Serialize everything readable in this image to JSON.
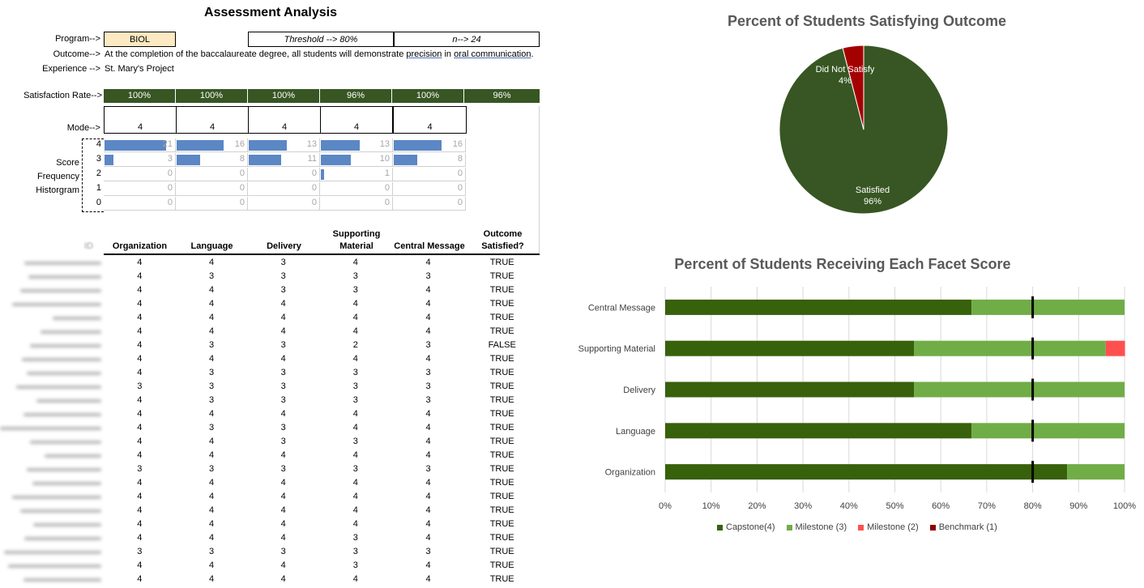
{
  "sheet": {
    "title": "Assessment Analysis",
    "program_label": "Program-->",
    "program_value": "BIOL",
    "threshold": "Threshold -->  80%",
    "n": "n-->  24",
    "outcome_label": "Outcome-->",
    "outcome_text_1": "At the completion of the baccalaureate degree, all students will demonstrate ",
    "outcome_word_1": "precision",
    "outcome_text_2": " in ",
    "outcome_word_2": "oral communication",
    "outcome_text_3": ".",
    "experience_label": "Experience -->",
    "experience_value": "St. Mary's Project",
    "satisfaction_label": "Satisfaction Rate-->",
    "satisfaction_rates": [
      "100%",
      "100%",
      "100%",
      "96%",
      "100%",
      "96%"
    ],
    "mode_label": "Mode-->",
    "modes": [
      "4",
      "4",
      "4",
      "4",
      "4"
    ],
    "hist_labels": [
      "Score",
      "Frequency",
      "Historgram"
    ],
    "hist_scores": [
      "4",
      "3",
      "2",
      "1",
      "0"
    ],
    "hist_counts": [
      [
        21,
        16,
        13,
        13,
        16
      ],
      [
        3,
        8,
        11,
        10,
        8
      ],
      [
        0,
        0,
        0,
        1,
        0
      ],
      [
        0,
        0,
        0,
        0,
        0
      ],
      [
        0,
        0,
        0,
        0,
        0
      ]
    ],
    "id_header": "ID",
    "columns": [
      "Organization",
      "Language",
      "Delivery",
      "Supporting Material",
      "Central Message",
      "Outcome Satisfied?"
    ],
    "rows": [
      [
        "4",
        "4",
        "3",
        "4",
        "4",
        "TRUE"
      ],
      [
        "4",
        "3",
        "3",
        "3",
        "3",
        "TRUE"
      ],
      [
        "4",
        "4",
        "3",
        "3",
        "4",
        "TRUE"
      ],
      [
        "4",
        "4",
        "4",
        "4",
        "4",
        "TRUE"
      ],
      [
        "4",
        "4",
        "4",
        "4",
        "4",
        "TRUE"
      ],
      [
        "4",
        "4",
        "4",
        "4",
        "4",
        "TRUE"
      ],
      [
        "4",
        "3",
        "3",
        "2",
        "3",
        "FALSE"
      ],
      [
        "4",
        "4",
        "4",
        "4",
        "4",
        "TRUE"
      ],
      [
        "4",
        "3",
        "3",
        "3",
        "3",
        "TRUE"
      ],
      [
        "3",
        "3",
        "3",
        "3",
        "3",
        "TRUE"
      ],
      [
        "4",
        "3",
        "3",
        "3",
        "3",
        "TRUE"
      ],
      [
        "4",
        "4",
        "4",
        "4",
        "4",
        "TRUE"
      ],
      [
        "4",
        "3",
        "3",
        "4",
        "4",
        "TRUE"
      ],
      [
        "4",
        "4",
        "3",
        "3",
        "4",
        "TRUE"
      ],
      [
        "4",
        "4",
        "4",
        "4",
        "4",
        "TRUE"
      ],
      [
        "3",
        "3",
        "3",
        "3",
        "3",
        "TRUE"
      ],
      [
        "4",
        "4",
        "4",
        "4",
        "4",
        "TRUE"
      ],
      [
        "4",
        "4",
        "4",
        "4",
        "4",
        "TRUE"
      ],
      [
        "4",
        "4",
        "4",
        "4",
        "4",
        "TRUE"
      ],
      [
        "4",
        "4",
        "4",
        "4",
        "4",
        "TRUE"
      ],
      [
        "4",
        "4",
        "4",
        "3",
        "4",
        "TRUE"
      ],
      [
        "3",
        "3",
        "3",
        "3",
        "3",
        "TRUE"
      ],
      [
        "4",
        "4",
        "4",
        "3",
        "4",
        "TRUE"
      ],
      [
        "4",
        "4",
        "4",
        "4",
        "4",
        "TRUE"
      ]
    ]
  },
  "colors": {
    "dark_green": "#375623",
    "capstone": "#38610b",
    "milestone3": "#70ad47",
    "milestone2": "#ff5050",
    "benchmark": "#8b0000",
    "hist_bar": "#5b87c5",
    "pie_satisfied": "#375623",
    "pie_not": "#a50000"
  },
  "chart_data": [
    {
      "type": "pie",
      "title": "Percent of Students Satisfying Outcome",
      "slices": [
        {
          "label": "Satisfied",
          "value": 96,
          "value_label": "96%"
        },
        {
          "label": "Did Not Satisfy",
          "value": 4,
          "value_label": "4%"
        }
      ]
    },
    {
      "type": "bar",
      "orientation": "horizontal",
      "stacked": true,
      "title": "Percent of Students Receiving Each Facet Score",
      "categories": [
        "Organization",
        "Language",
        "Delivery",
        "Supporting Material",
        "Central Message"
      ],
      "series": [
        {
          "name": "Capstone(4)",
          "values": [
            87.5,
            66.7,
            54.2,
            54.2,
            66.7
          ]
        },
        {
          "name": "Milestone (3)",
          "values": [
            12.5,
            33.3,
            45.8,
            41.7,
            33.3
          ]
        },
        {
          "name": "Milestone (2)",
          "values": [
            0,
            0,
            0,
            4.2,
            0
          ]
        },
        {
          "name": "Benchmark (1)",
          "values": [
            0,
            0,
            0,
            0,
            0
          ]
        }
      ],
      "benchmark_line": 80,
      "xlim": [
        0,
        100
      ],
      "x_ticks": [
        "0%",
        "10%",
        "20%",
        "30%",
        "40%",
        "50%",
        "60%",
        "70%",
        "80%",
        "90%",
        "100%"
      ],
      "legend_position": "bottom",
      "grid": true
    }
  ]
}
